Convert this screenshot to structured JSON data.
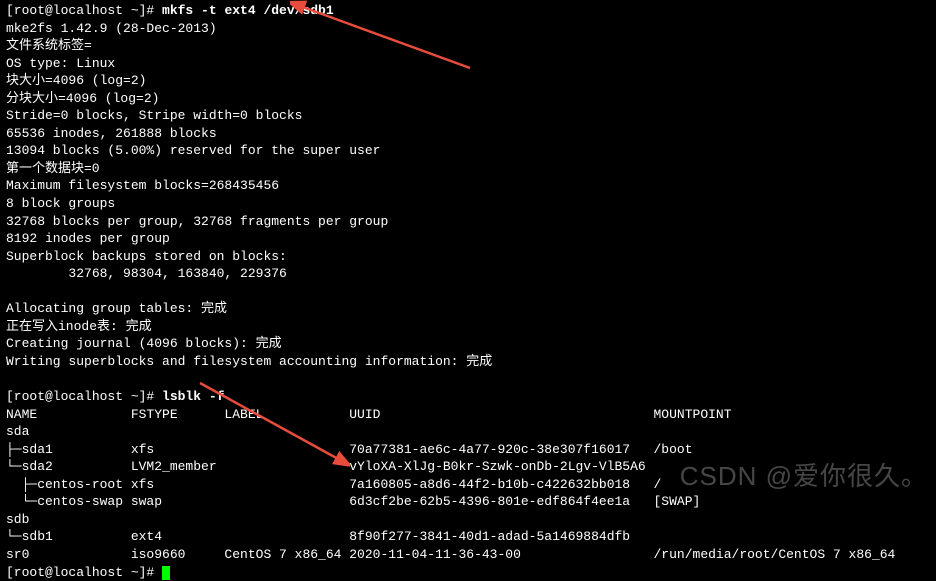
{
  "cmd1": {
    "prompt": "[root@localhost ~]# ",
    "command": "mkfs -t ext4 /dev/sdb1"
  },
  "mkfs": {
    "l1": "mke2fs 1.42.9 (28-Dec-2013)",
    "l2": "文件系统标签=",
    "l3": "OS type: Linux",
    "l4": "块大小=4096 (log=2)",
    "l5": "分块大小=4096 (log=2)",
    "l6": "Stride=0 blocks, Stripe width=0 blocks",
    "l7": "65536 inodes, 261888 blocks",
    "l8": "13094 blocks (5.00%) reserved for the super user",
    "l9": "第一个数据块=0",
    "l10": "Maximum filesystem blocks=268435456",
    "l11": "8 block groups",
    "l12": "32768 blocks per group, 32768 fragments per group",
    "l13": "8192 inodes per group",
    "l14": "Superblock backups stored on blocks:",
    "l15": "        32768, 98304, 163840, 229376",
    "l16": "Allocating group tables: 完成",
    "l17": "正在写入inode表: 完成",
    "l18": "Creating journal (4096 blocks): 完成",
    "l19": "Writing superblocks and filesystem accounting information: 完成"
  },
  "cmd2": {
    "prompt": "[root@localhost ~]# ",
    "command": "lsblk -f"
  },
  "lsblk": {
    "header": "NAME            FSTYPE      LABEL           UUID                                   MOUNTPOINT",
    "r1": "sda",
    "r2": "├─sda1          xfs                         70a77381-ae6c-4a77-920c-38e307f16017   /boot",
    "r3": "└─sda2          LVM2_member                 vYloXA-XlJg-B0kr-Szwk-onDb-2Lgv-VlB5A6",
    "r4": "  ├─centos-root xfs                         7a160805-a8d6-44f2-b10b-c422632bb018   /",
    "r5": "  └─centos-swap swap                        6d3cf2be-62b5-4396-801e-edf864f4ee1a   [SWAP]",
    "r6": "sdb",
    "r7": "└─sdb1          ext4                        8f90f277-3841-40d1-adad-5a1469884dfb",
    "r8": "sr0             iso9660     CentOS 7 x86_64 2020-11-04-11-36-43-00                 /run/media/root/CentOS 7 x86_64"
  },
  "cmd3": {
    "prompt": "[root@localhost ~]# "
  },
  "watermark": "CSDN @爱你很久。"
}
